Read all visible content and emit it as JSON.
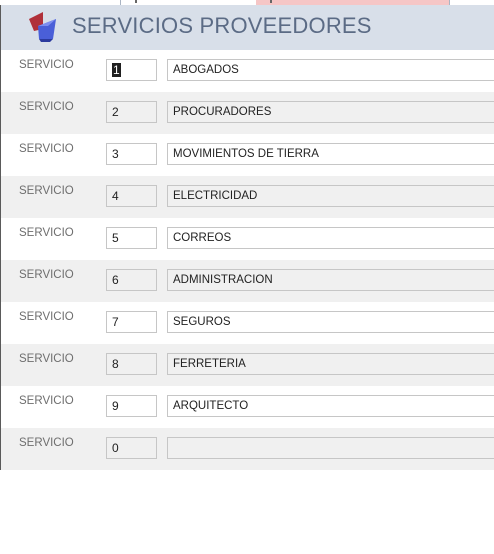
{
  "title": "SERVICIOS PROVEEDORES",
  "colors": {
    "header_bg": "#d8dfe9",
    "title": "#5b6b85",
    "alt_row": "#f0f0f0",
    "tab_active": "#f5c6c6"
  },
  "logo_icon": "access-form-logo-icon",
  "field_label": "SERVICIO",
  "rows": [
    {
      "label": "SERVICIO",
      "id": "1",
      "name": "ABOGADOS"
    },
    {
      "label": "SERVICIO",
      "id": "2",
      "name": "PROCURADORES"
    },
    {
      "label": "SERVICIO",
      "id": "3",
      "name": "MOVIMIENTOS DE TIERRA"
    },
    {
      "label": "SERVICIO",
      "id": "4",
      "name": "ELECTRICIDAD"
    },
    {
      "label": "SERVICIO",
      "id": "5",
      "name": "CORREOS"
    },
    {
      "label": "SERVICIO",
      "id": "6",
      "name": "ADMINISTRACION"
    },
    {
      "label": "SERVICIO",
      "id": "7",
      "name": "SEGUROS"
    },
    {
      "label": "SERVICIO",
      "id": "8",
      "name": "FERRETERIA"
    },
    {
      "label": "SERVICIO",
      "id": "9",
      "name": "ARQUITECTO"
    },
    {
      "label": "SERVICIO",
      "id": "0",
      "name": ""
    }
  ]
}
